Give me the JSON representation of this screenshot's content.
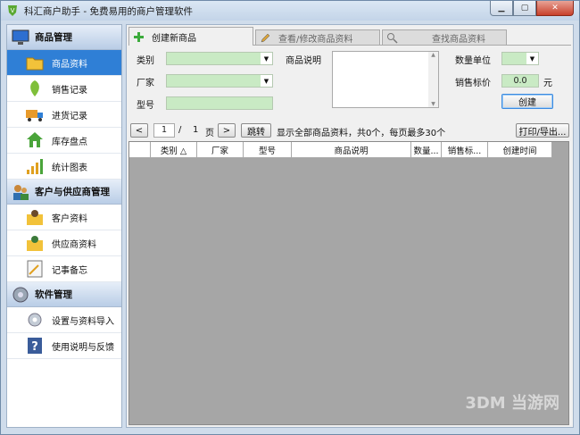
{
  "window": {
    "title": "科汇商户助手 - 免费易用的商户管理软件"
  },
  "sidebar": {
    "sections": [
      {
        "label": "商品管理",
        "items": [
          "商品资料",
          "销售记录",
          "进货记录",
          "库存盘点",
          "统计图表"
        ]
      },
      {
        "label": "客户与供应商管理",
        "items": [
          "客户资料",
          "供应商资料",
          "记事备忘"
        ]
      },
      {
        "label": "软件管理",
        "items": [
          "设置与资料导入",
          "使用说明与反馈"
        ]
      }
    ]
  },
  "tabs": [
    "创建新商品",
    "查看/修改商品资料",
    "查找商品资料"
  ],
  "form": {
    "category_label": "类别",
    "vendor_label": "厂家",
    "model_label": "型号",
    "desc_label": "商品说明",
    "unit_label": "数量单位",
    "price_label": "销售标价",
    "price_value": "0.0",
    "currency": "元",
    "create_button": "创建"
  },
  "pager": {
    "prev": "<",
    "page": "1",
    "slash": "/",
    "total": "1",
    "page_word": "页",
    "next": ">",
    "jump": "跳转",
    "status": "显示全部商品资料，共0个，每页最多30个",
    "print": "打印/导出..."
  },
  "grid": {
    "columns": [
      "",
      "类别 △",
      "厂家",
      "型号",
      "商品说明",
      "数量...",
      "销售标...",
      "创建时间"
    ]
  },
  "watermark": "3DM 当游网",
  "colors": {
    "selected": "#2f7fd6",
    "input_green": "#c9eac4"
  }
}
